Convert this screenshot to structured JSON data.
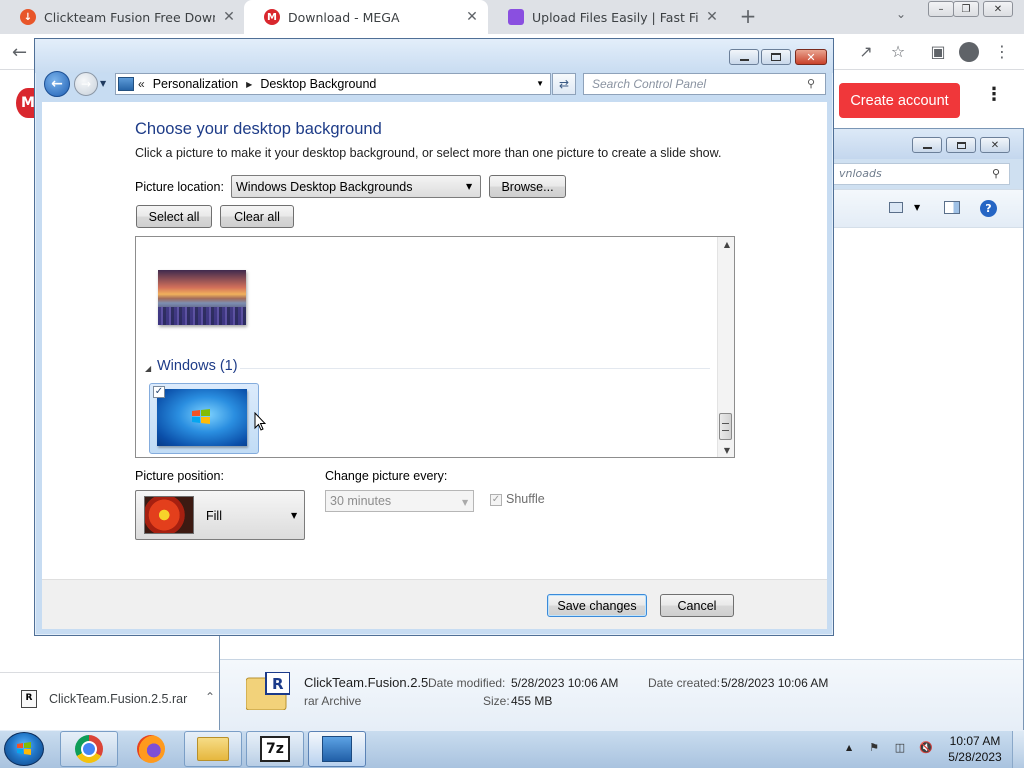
{
  "browser": {
    "tabs": [
      {
        "title": "Clickteam Fusion Free Download",
        "favicon_color": "#e8562a"
      },
      {
        "title": "Download - MEGA",
        "favicon_color": "#d9272e",
        "favicon_letter": "M"
      },
      {
        "title": "Upload Files Easily | Fast File Uplo",
        "favicon_color": "#8a4fe0"
      }
    ],
    "new_tab_label": "+",
    "create_account_label": "Create account",
    "download_shelf": {
      "filename": "ClickTeam.Fusion.2.5.rar"
    }
  },
  "explorer": {
    "search_placeholder": "Search Downloads",
    "search_visible_text": "vnloads",
    "file": {
      "name": "ClickTeam.Fusion.2.5",
      "type": "rar Archive",
      "date_modified_label": "Date modified:",
      "date_modified": "5/28/2023 10:06 AM",
      "date_created_label": "Date created:",
      "date_created": "5/28/2023 10:06 AM",
      "size_label": "Size:",
      "size": "455 MB"
    }
  },
  "control_panel": {
    "breadcrumb": {
      "prefix": "«",
      "items": [
        "Personalization",
        "Desktop Background"
      ]
    },
    "search_placeholder": "Search Control Panel",
    "heading": "Choose your desktop background",
    "subtitle": "Click a picture to make it your desktop background, or select more than one picture to create a slide show.",
    "picture_location_label": "Picture location:",
    "picture_location_value": "Windows Desktop Backgrounds",
    "browse_label": "Browse...",
    "select_all_label": "Select all",
    "clear_all_label": "Clear all",
    "gallery": {
      "group_title": "Windows (1)",
      "win7_selected": true
    },
    "picture_position_label": "Picture position:",
    "picture_position_value": "Fill",
    "change_picture_label": "Change picture every:",
    "change_picture_value": "30 minutes",
    "shuffle_label": "Shuffle",
    "shuffle_checked": true,
    "save_label": "Save changes",
    "cancel_label": "Cancel"
  },
  "taskbar": {
    "items": [
      "chrome",
      "firefox",
      "windows-explorer",
      "7-zip",
      "control-panel"
    ],
    "clock_time": "10:07 AM",
    "clock_date": "5/28/2023"
  }
}
